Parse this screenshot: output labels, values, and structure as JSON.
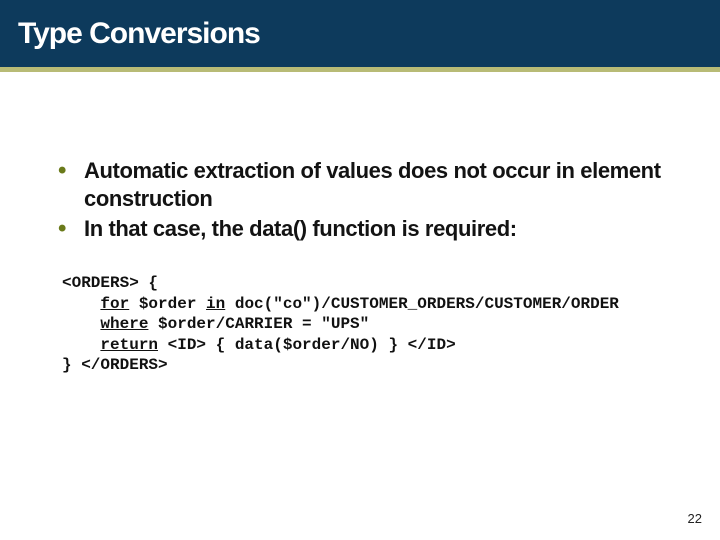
{
  "title": "Type Conversions",
  "bullets": [
    "Automatic extraction of values does not occur in element construction",
    "In that case, the data() function is required:"
  ],
  "code": {
    "open": "<ORDERS> {",
    "indent": "    ",
    "for_kw": "for",
    "for_rest": " $order ",
    "in_kw": "in",
    "in_rest": " doc(\"co\")/CUSTOMER_ORDERS/CUSTOMER/ORDER",
    "where_kw": "where",
    "where_rest": " $order/CARRIER = \"UPS\"",
    "return_kw": "return",
    "return_rest": " <ID> { data($order/NO) } </ID>",
    "close": "} </ORDERS>"
  },
  "page_number": "22"
}
